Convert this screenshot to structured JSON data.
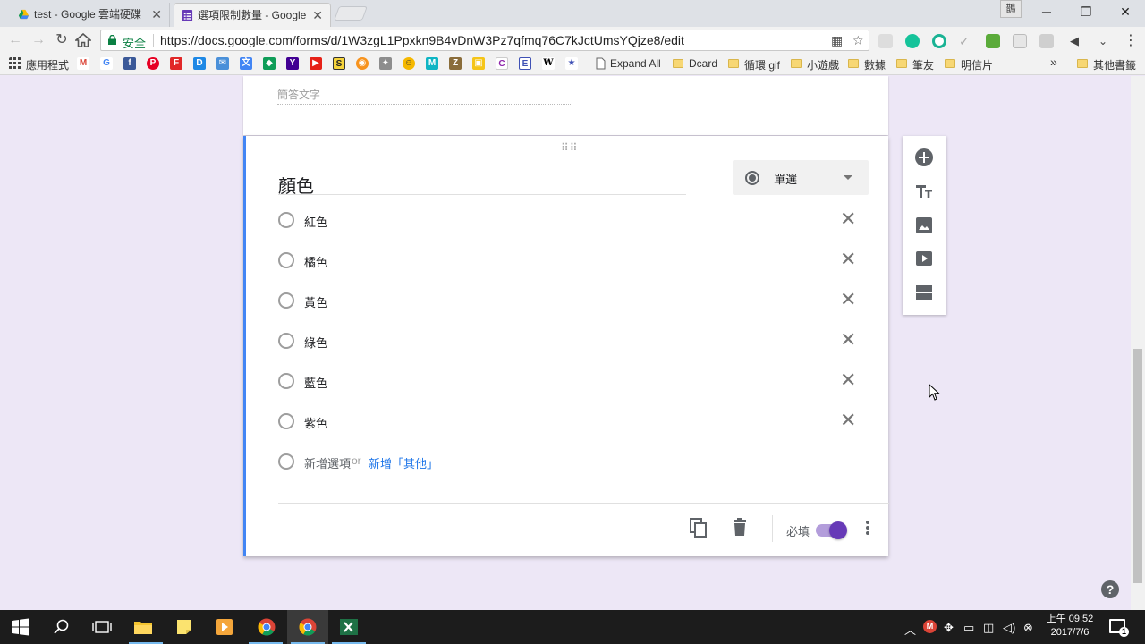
{
  "browser": {
    "tabs": [
      {
        "title": "test - Google 雲端硬碟",
        "active": false
      },
      {
        "title": "選項限制數量 - Google",
        "active": true
      }
    ],
    "profile": "鵲",
    "secure_label": "安全",
    "url": "https://docs.google.com/forms/d/1W3zgL1Ppxkn9B4vDnW3Pz7qfmq76C7kJctUmsYQjze8/edit",
    "bookmarks": {
      "apps": "應用程式",
      "expand_all": "Expand All",
      "dcard": "Dcard",
      "loop_gif": "循環 gif",
      "mini_games": "小遊戲",
      "data": "數據",
      "friends": "筆友",
      "postcards": "明信片",
      "more": "»",
      "other": "其他書籤"
    }
  },
  "form": {
    "previous_question": {
      "placeholder": "簡答文字"
    },
    "question": {
      "title": "顏色",
      "type": "單選",
      "options": [
        "紅色",
        "橘色",
        "黃色",
        "綠色",
        "藍色",
        "紫色"
      ],
      "add_option": "新增選項",
      "or": "or",
      "add_other": "新增「其他」",
      "required_label": "必填",
      "required": true
    },
    "side_tools": [
      "add-question-icon",
      "title-text-icon",
      "image-icon",
      "video-icon",
      "section-icon"
    ],
    "colors": {
      "accent": "#673ab7",
      "accent_light": "#b39ddb",
      "focus_border": "#4285f4",
      "background": "#ede7f6"
    }
  },
  "taskbar": {
    "time_period": "上午 09:52",
    "date": "2017/7/6",
    "notification_count": "1"
  }
}
